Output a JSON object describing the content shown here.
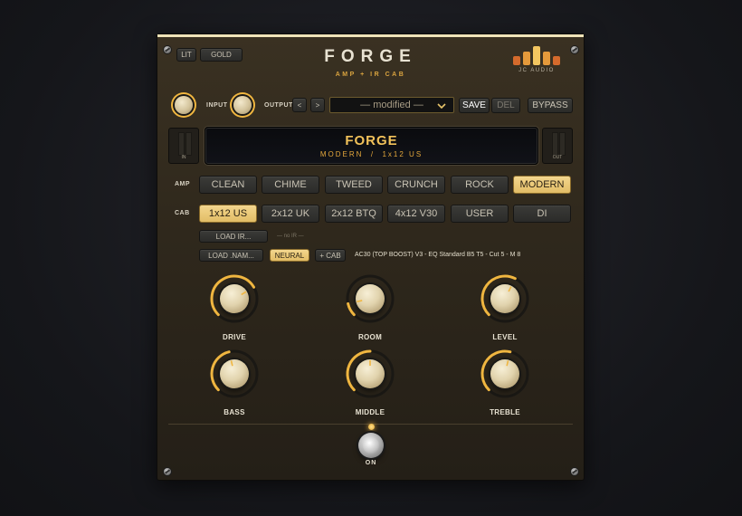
{
  "theme_buttons": [
    "LIT",
    "GOLD"
  ],
  "header": {
    "title": "FORGE",
    "subtitle": "AMP + IR CAB",
    "brand": "JC AUDIO"
  },
  "io": {
    "input_label": "INPUT",
    "output_label": "OUTPUT",
    "prev": "<",
    "next": ">"
  },
  "preset": {
    "name": "— modified —",
    "save": "SAVE",
    "delete": "DEL",
    "bypass": "BYPASS"
  },
  "display": {
    "amp_name": "FORGE",
    "chain": "MODERN  /  1x12 US"
  },
  "meters": {
    "in": "IN",
    "out": "OUT"
  },
  "amp": {
    "label": "AMP",
    "options": [
      "CLEAN",
      "CHIME",
      "TWEED",
      "CRUNCH",
      "ROCK",
      "MODERN"
    ],
    "selected": "MODERN"
  },
  "cab": {
    "label": "CAB",
    "options": [
      "1x12 US",
      "2x12 UK",
      "2x12 BTQ",
      "4x12 V30",
      "USER",
      "DI"
    ],
    "selected": "1x12 US"
  },
  "ir": {
    "load_ir": "LOAD IR...",
    "ir_status": "— no IR —",
    "load_nam": "LOAD .NAM...",
    "neural": "NEURAL",
    "plus_cab": "+ CAB",
    "nam_model": "AC30 (TOP BOOST) V3 - EQ Standard B5 T5 - Cut 5 - M 8"
  },
  "knobs": [
    {
      "label": "DRIVE",
      "value": 0.72
    },
    {
      "label": "ROOM",
      "value": 0.12
    },
    {
      "label": "LEVEL",
      "value": 0.6
    },
    {
      "label": "BASS",
      "value": 0.45
    },
    {
      "label": "MIDDLE",
      "value": 0.5
    },
    {
      "label": "TREBLE",
      "value": 0.55
    }
  ],
  "power": {
    "label": "ON",
    "on": true
  },
  "colors": {
    "accent": "#f0b640",
    "panel": "#2f281c",
    "display_text": "#f2c25a"
  },
  "icons": {
    "preset_dropdown": "chevron-down-icon",
    "brand": "jc-audio-logo"
  }
}
